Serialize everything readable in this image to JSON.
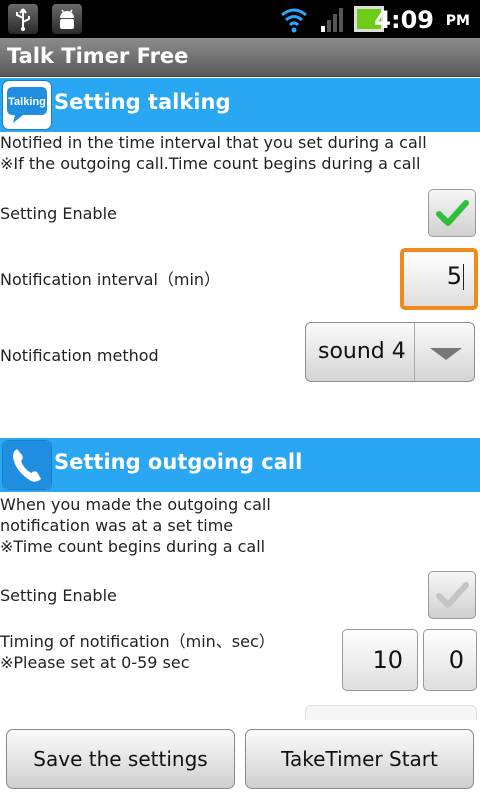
{
  "status_bar": {
    "time": "4:09",
    "ampm": "PM"
  },
  "app": {
    "title": "Talk Timer Free"
  },
  "talking": {
    "heading": "Setting talking",
    "icon_text": "Talking",
    "desc1": "Notified in the time interval that you set during a call",
    "desc2": "※If the outgoing call.Time count begins during a call",
    "enable_label": "Setting Enable",
    "enable_checked": true,
    "interval_label": "Notification interval（min）",
    "interval_value": "5",
    "method_label": "Notification method",
    "method_value": "sound 4"
  },
  "outgoing": {
    "heading": "Setting outgoing call",
    "desc1": "When you made the outgoing call",
    "desc2": "notification was at a set time",
    "desc3": "※Time count begins during a call",
    "enable_label": "Setting Enable",
    "enable_checked": false,
    "timing_label": "Timing of notification（min、sec）",
    "timing_hint": "※Please set at 0-59 sec",
    "min_value": "10",
    "sec_value": "0"
  },
  "buttons": {
    "save": "Save the settings",
    "start": "TakeTimer Start"
  },
  "colors": {
    "section": "#2aa7f2",
    "focus": "#f08a1c",
    "check": "#2fbf3a"
  }
}
